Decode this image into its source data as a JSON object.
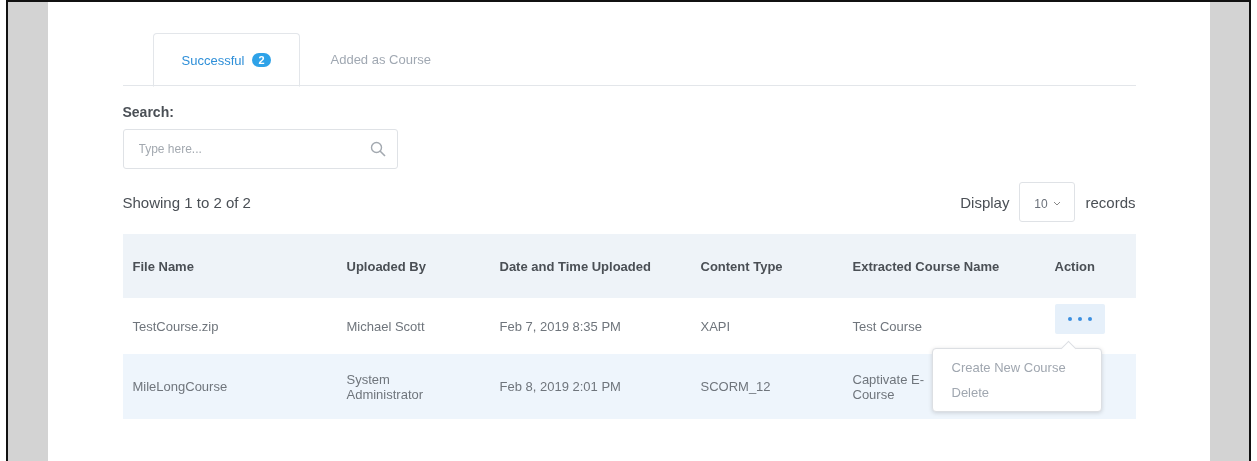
{
  "tabs": [
    {
      "label": "Successful",
      "badge": "2",
      "selected": true
    },
    {
      "label": "Added as Course",
      "selected": false
    }
  ],
  "search": {
    "label": "Search:",
    "placeholder": "Type here..."
  },
  "summary": "Showing 1 to 2 of 2",
  "page_size": {
    "before": "Display",
    "value": "10",
    "after": "records"
  },
  "table": {
    "columns": [
      "File Name",
      "Uploaded By",
      "Date and Time Uploaded",
      "Content Type",
      "Extracted Course Name",
      "Action"
    ],
    "rows": [
      {
        "cells": [
          "TestCourse.zip",
          "Michael Scott",
          "Feb 7, 2019 8:35 PM",
          "XAPI",
          "Test Course"
        ],
        "menu_open": true
      },
      {
        "cells": [
          "MileLongCourse",
          "System Administrator",
          "Feb 8, 2019 2:01 PM",
          "SCORM_12",
          "Captivate E-\nCourse"
        ],
        "menu_open": false
      }
    ]
  },
  "action_menu": {
    "items": [
      "Create New Course",
      "Delete"
    ]
  }
}
